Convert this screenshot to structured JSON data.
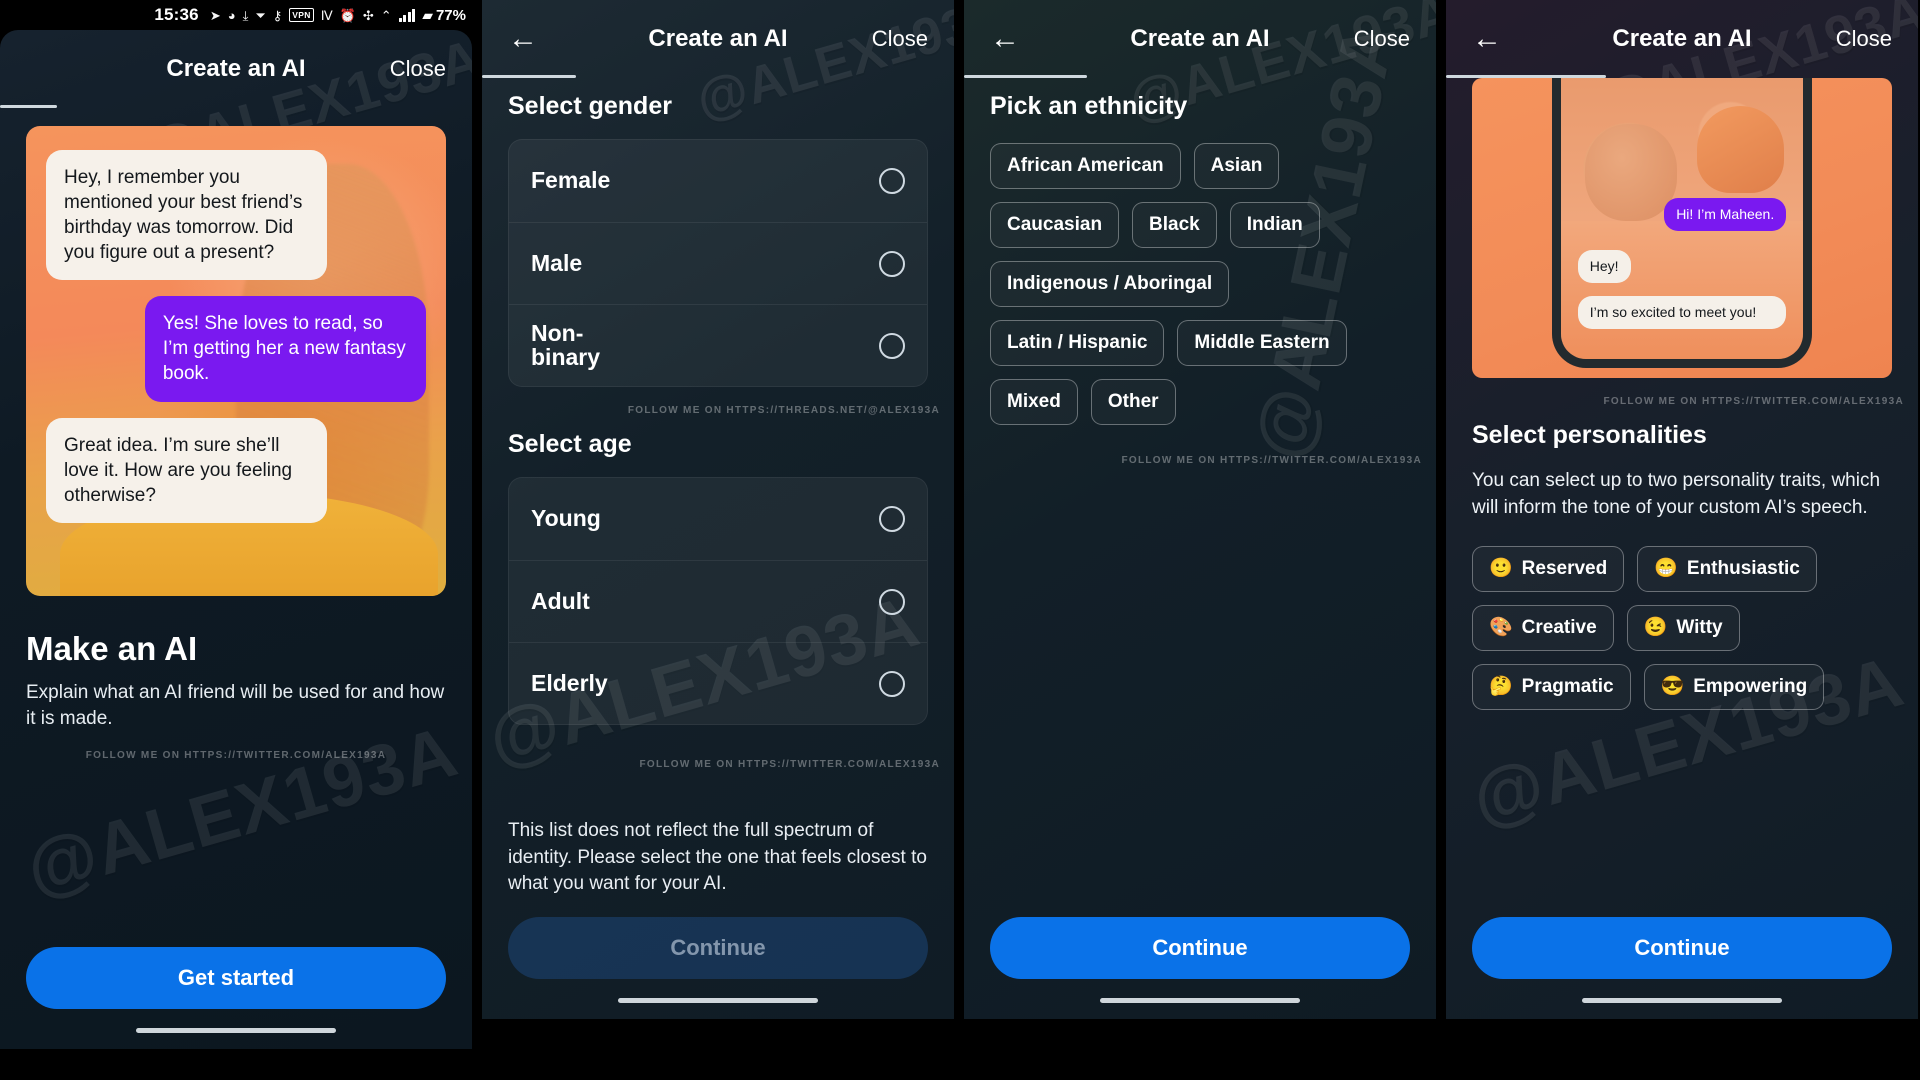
{
  "status_bar": {
    "clock": "15:36",
    "icons": [
      "telegram-icon",
      "compass-icon",
      "download-icon",
      "location-icon",
      "usb-icon",
      "vpn-badge",
      "nfc-icon",
      "alarm-icon",
      "bluetooth-icon",
      "wifi-icon",
      "signal-bars",
      "battery-icon"
    ],
    "vpn_label": "VPN",
    "battery_percent": "77%"
  },
  "watermarks": {
    "handle": "@ALEX193A",
    "follow_twitter": "FOLLOW ME ON HTTPS://TWITTER.COM/ALEX193A",
    "follow_threads": "FOLLOW ME ON HTTPS://THREADS.NET/@ALEX193A"
  },
  "panels": [
    {
      "id": "intro",
      "topbar": {
        "title": "Create an AI",
        "close_label": "Close",
        "has_back": false,
        "progress_percent": 12
      },
      "hero": {
        "messages": [
          {
            "side": "in",
            "text": "Hey, I remember you mentioned your best friend’s birthday was tomorrow. Did you figure out a present?"
          },
          {
            "side": "out",
            "text": "Yes! She loves to read, so I’m getting her a new fantasy book."
          },
          {
            "side": "in",
            "text": "Great idea. I’m sure she’ll love it. How are you feeling otherwise?"
          }
        ]
      },
      "title": "Make an AI",
      "subtitle": "Explain what an AI friend will be used for and how it is made.",
      "follow_line": "FOLLOW ME ON HTTPS://TWITTER.COM/ALEX193A",
      "cta": {
        "label": "Get started",
        "disabled": false
      }
    },
    {
      "id": "gender-age",
      "topbar": {
        "title": "Create an AI",
        "close_label": "Close",
        "has_back": true,
        "back_icon": "arrow-left-icon",
        "progress_percent": 20
      },
      "section_gender": {
        "heading": "Select gender",
        "options": [
          {
            "label": "Female",
            "selected": false
          },
          {
            "label": "Male",
            "selected": false
          },
          {
            "label": "Non-binary",
            "selected": false
          }
        ]
      },
      "follow_line_mid": "FOLLOW ME ON HTTPS://THREADS.NET/@ALEX193A",
      "section_age": {
        "heading": "Select age",
        "options": [
          {
            "label": "Young",
            "selected": false
          },
          {
            "label": "Adult",
            "selected": false
          },
          {
            "label": "Elderly",
            "selected": false
          }
        ]
      },
      "follow_line": "FOLLOW ME ON HTTPS://TWITTER.COM/ALEX193A",
      "disclaimer": "This list does not reflect the full spectrum of identity.  Please select the one that feels closest to what you want for your AI.",
      "cta": {
        "label": "Continue",
        "disabled": true
      }
    },
    {
      "id": "ethnicity",
      "topbar": {
        "title": "Create an AI",
        "close_label": "Close",
        "has_back": true,
        "back_icon": "arrow-left-icon",
        "progress_percent": 26
      },
      "heading": "Pick an ethnicity",
      "chips": [
        "African American",
        "Asian",
        "Caucasian",
        "Black",
        "Indian",
        "Indigenous / Aboringal",
        "Latin / Hispanic",
        "Middle Eastern",
        "Mixed",
        "Other"
      ],
      "follow_line": "FOLLOW ME ON HTTPS://TWITTER.COM/ALEX193A",
      "cta": {
        "label": "Continue",
        "disabled": false
      }
    },
    {
      "id": "personalities",
      "topbar": {
        "title": "Create an AI",
        "close_label": "Close",
        "has_back": true,
        "back_icon": "arrow-left-icon",
        "progress_percent": 34
      },
      "mock": {
        "messages": [
          {
            "side": "out",
            "text": "Hi! I’m Maheen."
          },
          {
            "side": "in",
            "text": "Hey!"
          },
          {
            "side": "in",
            "text": "I’m so excited to meet you!"
          }
        ]
      },
      "follow_line": "FOLLOW ME ON HTTPS://TWITTER.COM/ALEX193A",
      "heading": "Select personalities",
      "body": "You can select up to two personality traits, which will inform the tone of your custom AI’s speech.",
      "chips": [
        {
          "emoji": "🙂",
          "label": "Reserved"
        },
        {
          "emoji": "😁",
          "label": "Enthusiastic"
        },
        {
          "emoji": "🎨",
          "label": "Creative"
        },
        {
          "emoji": "😉",
          "label": "Witty"
        },
        {
          "emoji": "🤔",
          "label": "Pragmatic"
        },
        {
          "emoji": "😎",
          "label": "Empowering"
        }
      ],
      "cta": {
        "label": "Continue",
        "disabled": false
      }
    }
  ],
  "colors": {
    "accent_blue": "#0a72e8",
    "bubble_purple": "#7a19f0",
    "bubble_cream": "#f6f1ea",
    "panel_bg": "#0d1b26",
    "hero_orange": "#f4895a"
  }
}
